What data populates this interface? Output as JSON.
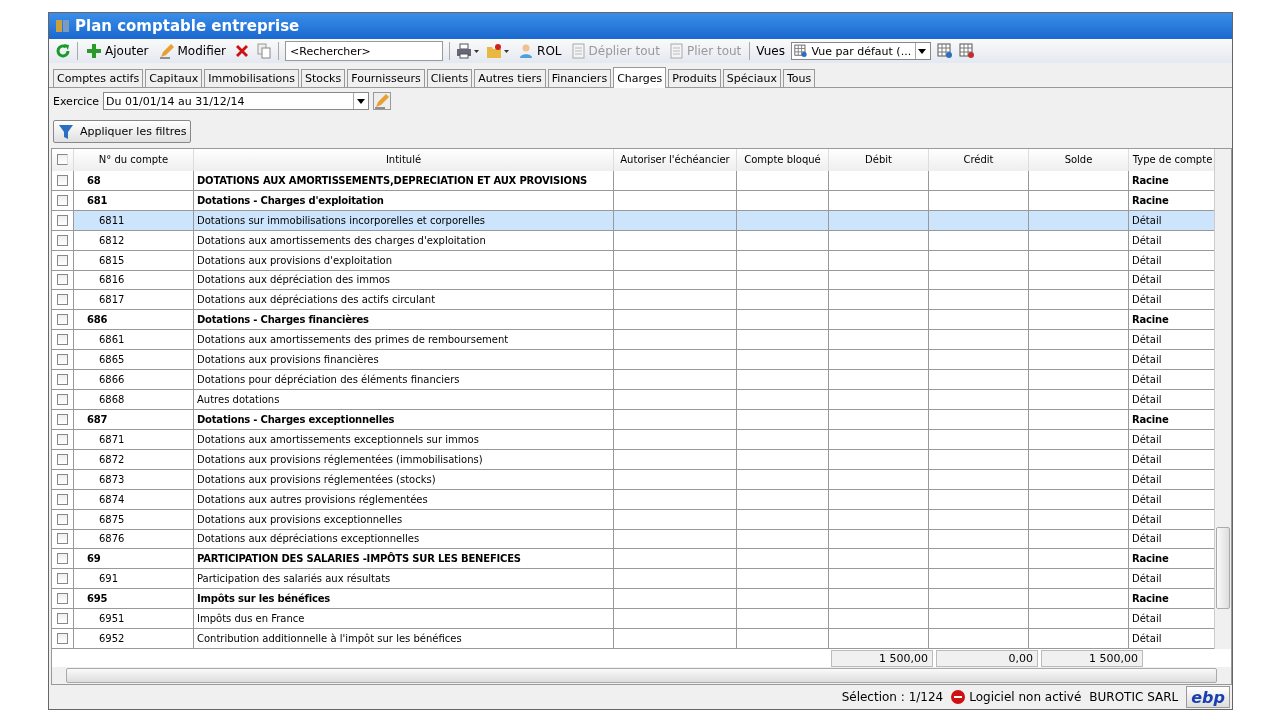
{
  "window": {
    "title": "Plan comptable entreprise"
  },
  "toolbar": {
    "add": "Ajouter",
    "edit": "Modifier",
    "search": {
      "placeholder": "<Rechercher>"
    },
    "rol": "ROL",
    "expand_all": {
      "label": "Déplier tout",
      "disabled": true
    },
    "collapse_all": {
      "label": "Plier tout",
      "disabled": true
    },
    "views_label": "Vues",
    "view": "Vue par défaut (..."
  },
  "tabs": [
    {
      "label": "Comptes actifs",
      "selected": false
    },
    {
      "label": "Capitaux",
      "selected": false
    },
    {
      "label": "Immobilisations",
      "selected": false
    },
    {
      "label": "Stocks",
      "selected": false
    },
    {
      "label": "Fournisseurs",
      "selected": false
    },
    {
      "label": "Clients",
      "selected": false
    },
    {
      "label": "Autres tiers",
      "selected": false
    },
    {
      "label": "Financiers",
      "selected": false
    },
    {
      "label": "Charges",
      "selected": true
    },
    {
      "label": "Produits",
      "selected": false
    },
    {
      "label": "Spéciaux",
      "selected": false
    },
    {
      "label": "Tous",
      "selected": false
    }
  ],
  "exercice": {
    "label": "Exercice",
    "value": "Du 01/01/14 au 31/12/14"
  },
  "filter_button": "Appliquer les filtres",
  "table": {
    "select_all_checked": false,
    "columns": [
      "N° du compte",
      "Intitulé",
      "Autoriser l'échéancier",
      "Compte bloqué",
      "Débit",
      "Crédit",
      "Solde",
      "Type de compte"
    ],
    "rows": [
      {
        "kind": "group",
        "number": "68",
        "label": "DOTATIONS AUX AMORTISSEMENTS,DEPRECIATION ET AUX PROVISIONS",
        "type": "Racine",
        "selected": false,
        "checked": false
      },
      {
        "kind": "group",
        "number": "681",
        "label": "Dotations - Charges d'exploitation",
        "type": "Racine",
        "selected": false,
        "checked": false
      },
      {
        "kind": "detail",
        "number": "6811",
        "label": "Dotations sur immobilisations incorporelles et corporelles",
        "type": "Détail",
        "selected": true,
        "checked": false
      },
      {
        "kind": "detail",
        "number": "6812",
        "label": "Dotations aux amortissements des charges d'exploitation",
        "type": "Détail",
        "selected": false,
        "checked": false
      },
      {
        "kind": "detail",
        "number": "6815",
        "label": "Dotations aux provisions d'exploitation",
        "type": "Détail",
        "selected": false,
        "checked": false
      },
      {
        "kind": "detail",
        "number": "6816",
        "label": "Dotations aux dépréciation des immos",
        "type": "Détail",
        "selected": false,
        "checked": false
      },
      {
        "kind": "detail",
        "number": "6817",
        "label": "Dotations aux dépréciations des actifs circulant",
        "type": "Détail",
        "selected": false,
        "checked": false
      },
      {
        "kind": "group",
        "number": "686",
        "label": "Dotations - Charges financières",
        "type": "Racine",
        "selected": false,
        "checked": false
      },
      {
        "kind": "detail",
        "number": "6861",
        "label": "Dotations aux amortissements des primes de remboursement",
        "type": "Détail",
        "selected": false,
        "checked": false
      },
      {
        "kind": "detail",
        "number": "6865",
        "label": "Dotations aux provisions financières",
        "type": "Détail",
        "selected": false,
        "checked": false
      },
      {
        "kind": "detail",
        "number": "6866",
        "label": "Dotations pour dépréciation des éléments financiers",
        "type": "Détail",
        "selected": false,
        "checked": false
      },
      {
        "kind": "detail",
        "number": "6868",
        "label": "Autres dotations",
        "type": "Détail",
        "selected": false,
        "checked": false
      },
      {
        "kind": "group",
        "number": "687",
        "label": "Dotations  - Charges exceptionnelles",
        "type": "Racine",
        "selected": false,
        "checked": false
      },
      {
        "kind": "detail",
        "number": "6871",
        "label": "Dotations aux amortissements exceptionnels sur immos",
        "type": "Détail",
        "selected": false,
        "checked": false
      },
      {
        "kind": "detail",
        "number": "6872",
        "label": "Dotations aux provisions réglementées (immobilisations)",
        "type": "Détail",
        "selected": false,
        "checked": false
      },
      {
        "kind": "detail",
        "number": "6873",
        "label": "Dotations aux provisions réglementées (stocks)",
        "type": "Détail",
        "selected": false,
        "checked": false
      },
      {
        "kind": "detail",
        "number": "6874",
        "label": "Dotations aux autres provisions réglementées",
        "type": "Détail",
        "selected": false,
        "checked": false
      },
      {
        "kind": "detail",
        "number": "6875",
        "label": "Dotations aux provisions exceptionnelles",
        "type": "Détail",
        "selected": false,
        "checked": false
      },
      {
        "kind": "detail",
        "number": "6876",
        "label": "Dotations aux dépréciations exceptionnelles",
        "type": "Détail",
        "selected": false,
        "checked": false
      },
      {
        "kind": "group",
        "number": "69",
        "label": "PARTICIPATION DES SALARIES -IMPÔTS SUR LES BENEFICES",
        "type": "Racine",
        "selected": false,
        "checked": false
      },
      {
        "kind": "detail",
        "number": "691",
        "label": "Participation des salariés aux résultats",
        "type": "Détail",
        "selected": false,
        "checked": false
      },
      {
        "kind": "group",
        "number": "695",
        "label": "Impôts sur les bénéfices",
        "type": "Racine",
        "selected": false,
        "checked": false
      },
      {
        "kind": "detail",
        "number": "6951",
        "label": "Impôts dus en France",
        "type": "Détail",
        "selected": false,
        "checked": false
      },
      {
        "kind": "detail",
        "number": "6952",
        "label": "Contribution additionnelle à l'impôt sur les bénéfices",
        "type": "Détail",
        "selected": false,
        "checked": false
      }
    ],
    "totals": {
      "debit": "1 500,00",
      "credit": "0,00",
      "balance": "1 500,00"
    }
  },
  "status_bar": {
    "selection": "Sélection : 1/124",
    "activation": "Logiciel non activé",
    "company": "BUROTIC SARL",
    "logo": "ebp"
  }
}
